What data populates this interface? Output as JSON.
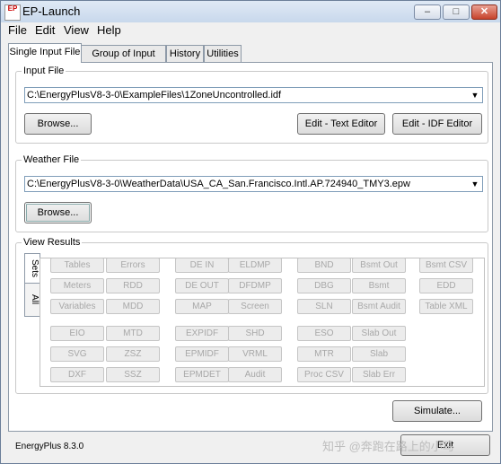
{
  "window": {
    "title": "EP-Launch",
    "app_icon_text": "EP",
    "controls": {
      "minimize": "–",
      "maximize": "□",
      "close": "✕"
    }
  },
  "menu": [
    "File",
    "Edit",
    "View",
    "Help"
  ],
  "tabs": [
    "Single Input File",
    "Group of Input Files",
    "History",
    "Utilities"
  ],
  "input_file": {
    "legend": "Input File",
    "value": "C:\\EnergyPlusV8-3-0\\ExampleFiles\\1ZoneUncontrolled.idf",
    "browse": "Browse...",
    "edit_text": "Edit - Text Editor",
    "edit_idf": "Edit - IDF Editor"
  },
  "weather_file": {
    "legend": "Weather File",
    "value": "C:\\EnergyPlusV8-3-0\\WeatherData\\USA_CA_San.Francisco.Intl.AP.724940_TMY3.epw",
    "browse": "Browse..."
  },
  "view_results": {
    "legend": "View Results",
    "side_tabs": [
      "Sets",
      "All"
    ],
    "buttons": [
      [
        "Tables",
        "Errors",
        "DE IN",
        "ELDMP",
        "BND",
        "Bsmt Out",
        "Bsmt CSV"
      ],
      [
        "Meters",
        "RDD",
        "DE OUT",
        "DFDMP",
        "DBG",
        "Bsmt",
        "EDD"
      ],
      [
        "Variables",
        "MDD",
        "MAP",
        "Screen",
        "SLN",
        "Bsmt Audit",
        "Table XML"
      ],
      [
        "EIO",
        "MTD",
        "EXPIDF",
        "SHD",
        "ESO",
        "Slab Out"
      ],
      [
        "SVG",
        "ZSZ",
        "EPMIDF",
        "VRML",
        "MTR",
        "Slab"
      ],
      [
        "DXF",
        "SSZ",
        "EPMDET",
        "Audit",
        "Proc CSV",
        "Slab Err"
      ]
    ]
  },
  "simulate": "Simulate...",
  "exit": "Exit",
  "status": "EnergyPlus 8.3.0",
  "watermark": "知乎 @奔跑在路上的小马"
}
